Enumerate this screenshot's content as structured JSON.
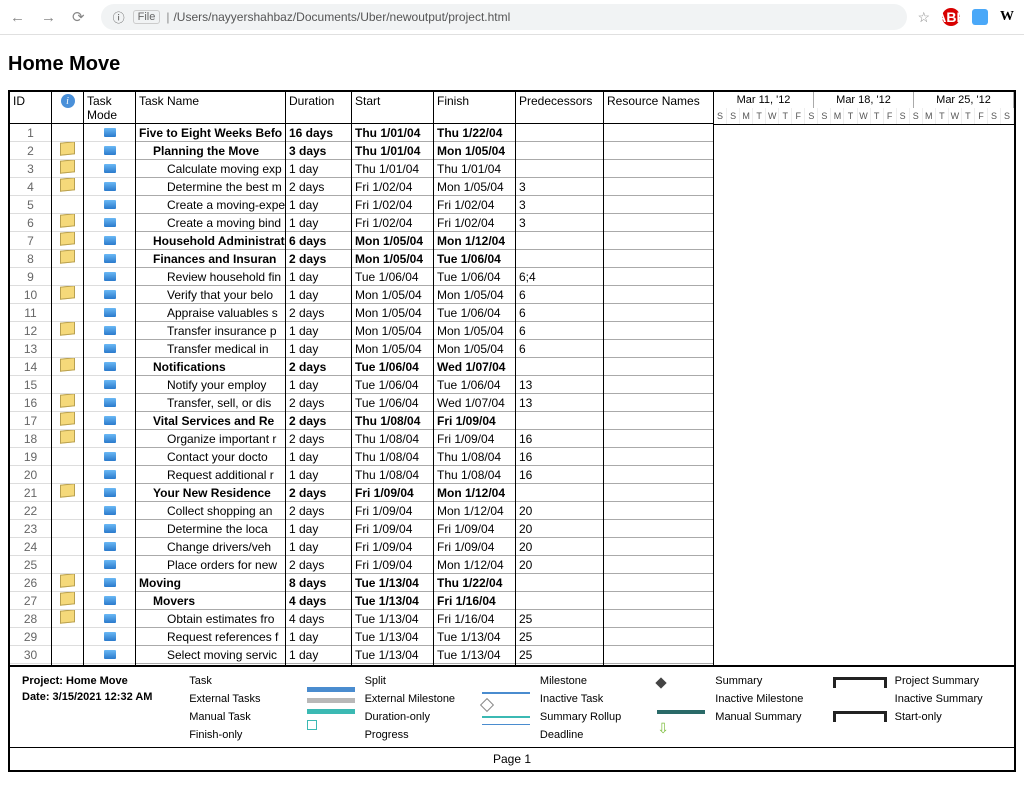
{
  "browser": {
    "url": "/Users/nayyershahbaz/Documents/Uber/newoutput/project.html",
    "file_label": "File"
  },
  "title": "Home Move",
  "project_info": {
    "name_label": "Project: Home Move",
    "date_label": "Date: 3/15/2021 12:32 AM"
  },
  "page_footer": "Page 1",
  "columns": {
    "id": "ID",
    "info": "",
    "mode": "Task Mode",
    "name": "Task Name",
    "dur": "Duration",
    "start": "Start",
    "fin": "Finish",
    "pred": "Predecessors",
    "res": "Resource Names"
  },
  "timeline": {
    "months": [
      "Mar 11, '12",
      "Mar 18, '12",
      "Mar 25, '12"
    ],
    "days": [
      "S",
      "S",
      "M",
      "T",
      "W",
      "T",
      "F",
      "S",
      "S",
      "M",
      "T",
      "W",
      "T",
      "F",
      "S",
      "S",
      "M",
      "T",
      "W",
      "T",
      "F",
      "S",
      "S"
    ]
  },
  "rows": [
    {
      "id": "1",
      "note": false,
      "bold": true,
      "indent": 0,
      "name": "Five to Eight Weeks Befo",
      "dur": "16 days",
      "start": "Thu 1/01/04",
      "fin": "Thu 1/22/04",
      "pred": ""
    },
    {
      "id": "2",
      "note": true,
      "bold": true,
      "indent": 1,
      "name": "Planning the Move",
      "dur": "3 days",
      "start": "Thu 1/01/04",
      "fin": "Mon 1/05/04",
      "pred": ""
    },
    {
      "id": "3",
      "note": true,
      "bold": false,
      "indent": 2,
      "name": "Calculate moving exp",
      "dur": "1 day",
      "start": "Thu 1/01/04",
      "fin": "Thu 1/01/04",
      "pred": ""
    },
    {
      "id": "4",
      "note": true,
      "bold": false,
      "indent": 2,
      "name": "Determine the best m",
      "dur": "2 days",
      "start": "Fri 1/02/04",
      "fin": "Mon 1/05/04",
      "pred": "3"
    },
    {
      "id": "5",
      "note": false,
      "bold": false,
      "indent": 2,
      "name": "Create a moving-expe",
      "dur": "1 day",
      "start": "Fri 1/02/04",
      "fin": "Fri 1/02/04",
      "pred": "3"
    },
    {
      "id": "6",
      "note": true,
      "bold": false,
      "indent": 2,
      "name": "Create a moving bind",
      "dur": "1 day",
      "start": "Fri 1/02/04",
      "fin": "Fri 1/02/04",
      "pred": "3"
    },
    {
      "id": "7",
      "note": true,
      "bold": true,
      "indent": 1,
      "name": "Household Administratio",
      "dur": "6 days",
      "start": "Mon 1/05/04",
      "fin": "Mon 1/12/04",
      "pred": ""
    },
    {
      "id": "8",
      "note": true,
      "bold": true,
      "indent": 1,
      "name": "Finances and Insuran",
      "dur": "2 days",
      "start": "Mon 1/05/04",
      "fin": "Tue 1/06/04",
      "pred": ""
    },
    {
      "id": "9",
      "note": false,
      "bold": false,
      "indent": 2,
      "name": "Review household fin",
      "dur": "1 day",
      "start": "Tue 1/06/04",
      "fin": "Tue 1/06/04",
      "pred": "6;4"
    },
    {
      "id": "10",
      "note": true,
      "bold": false,
      "indent": 2,
      "name": "Verify that your belo",
      "dur": "1 day",
      "start": "Mon 1/05/04",
      "fin": "Mon 1/05/04",
      "pred": "6"
    },
    {
      "id": "11",
      "note": false,
      "bold": false,
      "indent": 2,
      "name": "Appraise valuables s",
      "dur": "2 days",
      "start": "Mon 1/05/04",
      "fin": "Tue 1/06/04",
      "pred": "6"
    },
    {
      "id": "12",
      "note": true,
      "bold": false,
      "indent": 2,
      "name": "Transfer insurance p",
      "dur": "1 day",
      "start": "Mon 1/05/04",
      "fin": "Mon 1/05/04",
      "pred": "6"
    },
    {
      "id": "13",
      "note": false,
      "bold": false,
      "indent": 2,
      "name": "Transfer medical in",
      "dur": "1 day",
      "start": "Mon 1/05/04",
      "fin": "Mon 1/05/04",
      "pred": "6"
    },
    {
      "id": "14",
      "note": true,
      "bold": true,
      "indent": 1,
      "name": "Notifications",
      "dur": "2 days",
      "start": "Tue 1/06/04",
      "fin": "Wed 1/07/04",
      "pred": ""
    },
    {
      "id": "15",
      "note": false,
      "bold": false,
      "indent": 2,
      "name": "Notify your employ",
      "dur": "1 day",
      "start": "Tue 1/06/04",
      "fin": "Tue 1/06/04",
      "pred": "13"
    },
    {
      "id": "16",
      "note": true,
      "bold": false,
      "indent": 2,
      "name": "Transfer, sell, or dis",
      "dur": "2 days",
      "start": "Tue 1/06/04",
      "fin": "Wed 1/07/04",
      "pred": "13"
    },
    {
      "id": "17",
      "note": true,
      "bold": true,
      "indent": 1,
      "name": "Vital Services and Re",
      "dur": "2 days",
      "start": "Thu 1/08/04",
      "fin": "Fri 1/09/04",
      "pred": ""
    },
    {
      "id": "18",
      "note": true,
      "bold": false,
      "indent": 2,
      "name": "Organize important r",
      "dur": "2 days",
      "start": "Thu 1/08/04",
      "fin": "Fri 1/09/04",
      "pred": "16"
    },
    {
      "id": "19",
      "note": false,
      "bold": false,
      "indent": 2,
      "name": "Contact your docto",
      "dur": "1 day",
      "start": "Thu 1/08/04",
      "fin": "Thu 1/08/04",
      "pred": "16"
    },
    {
      "id": "20",
      "note": false,
      "bold": false,
      "indent": 2,
      "name": "Request additional r",
      "dur": "1 day",
      "start": "Thu 1/08/04",
      "fin": "Thu 1/08/04",
      "pred": "16"
    },
    {
      "id": "21",
      "note": true,
      "bold": true,
      "indent": 1,
      "name": "Your New Residence",
      "dur": "2 days",
      "start": "Fri 1/09/04",
      "fin": "Mon 1/12/04",
      "pred": ""
    },
    {
      "id": "22",
      "note": false,
      "bold": false,
      "indent": 2,
      "name": "Collect shopping an",
      "dur": "2 days",
      "start": "Fri 1/09/04",
      "fin": "Mon 1/12/04",
      "pred": "20"
    },
    {
      "id": "23",
      "note": false,
      "bold": false,
      "indent": 2,
      "name": "Determine the loca",
      "dur": "1 day",
      "start": "Fri 1/09/04",
      "fin": "Fri 1/09/04",
      "pred": "20"
    },
    {
      "id": "24",
      "note": false,
      "bold": false,
      "indent": 2,
      "name": "Change drivers/veh",
      "dur": "1 day",
      "start": "Fri 1/09/04",
      "fin": "Fri 1/09/04",
      "pred": "20"
    },
    {
      "id": "25",
      "note": false,
      "bold": false,
      "indent": 2,
      "name": "Place orders for new",
      "dur": "2 days",
      "start": "Fri 1/09/04",
      "fin": "Mon 1/12/04",
      "pred": "20"
    },
    {
      "id": "26",
      "note": true,
      "bold": true,
      "indent": 0,
      "name": "Moving",
      "dur": "8 days",
      "start": "Tue 1/13/04",
      "fin": "Thu 1/22/04",
      "pred": ""
    },
    {
      "id": "27",
      "note": true,
      "bold": true,
      "indent": 1,
      "name": "Movers",
      "dur": "4 days",
      "start": "Tue 1/13/04",
      "fin": "Fri 1/16/04",
      "pred": ""
    },
    {
      "id": "28",
      "note": true,
      "bold": false,
      "indent": 2,
      "name": "Obtain estimates fro",
      "dur": "4 days",
      "start": "Tue 1/13/04",
      "fin": "Fri 1/16/04",
      "pred": "25"
    },
    {
      "id": "29",
      "note": false,
      "bold": false,
      "indent": 2,
      "name": "Request references f",
      "dur": "1 day",
      "start": "Tue 1/13/04",
      "fin": "Tue 1/13/04",
      "pred": "25"
    },
    {
      "id": "30",
      "note": false,
      "bold": false,
      "indent": 2,
      "name": "Select moving servic",
      "dur": "1 day",
      "start": "Tue 1/13/04",
      "fin": "Tue 1/13/04",
      "pred": "25"
    }
  ],
  "legend": {
    "col1": [
      "Task",
      "External Tasks",
      "Manual Task",
      "Finish-only"
    ],
    "col2": [
      "Split",
      "External Milestone",
      "Duration-only",
      "Progress"
    ],
    "col3": [
      "Milestone",
      "Inactive Task",
      "Summary Rollup",
      "Deadline"
    ],
    "col4": [
      "Summary",
      "Inactive Milestone",
      "Manual Summary",
      ""
    ],
    "col5": [
      "Project Summary",
      "Inactive Summary",
      "Start-only",
      ""
    ]
  }
}
